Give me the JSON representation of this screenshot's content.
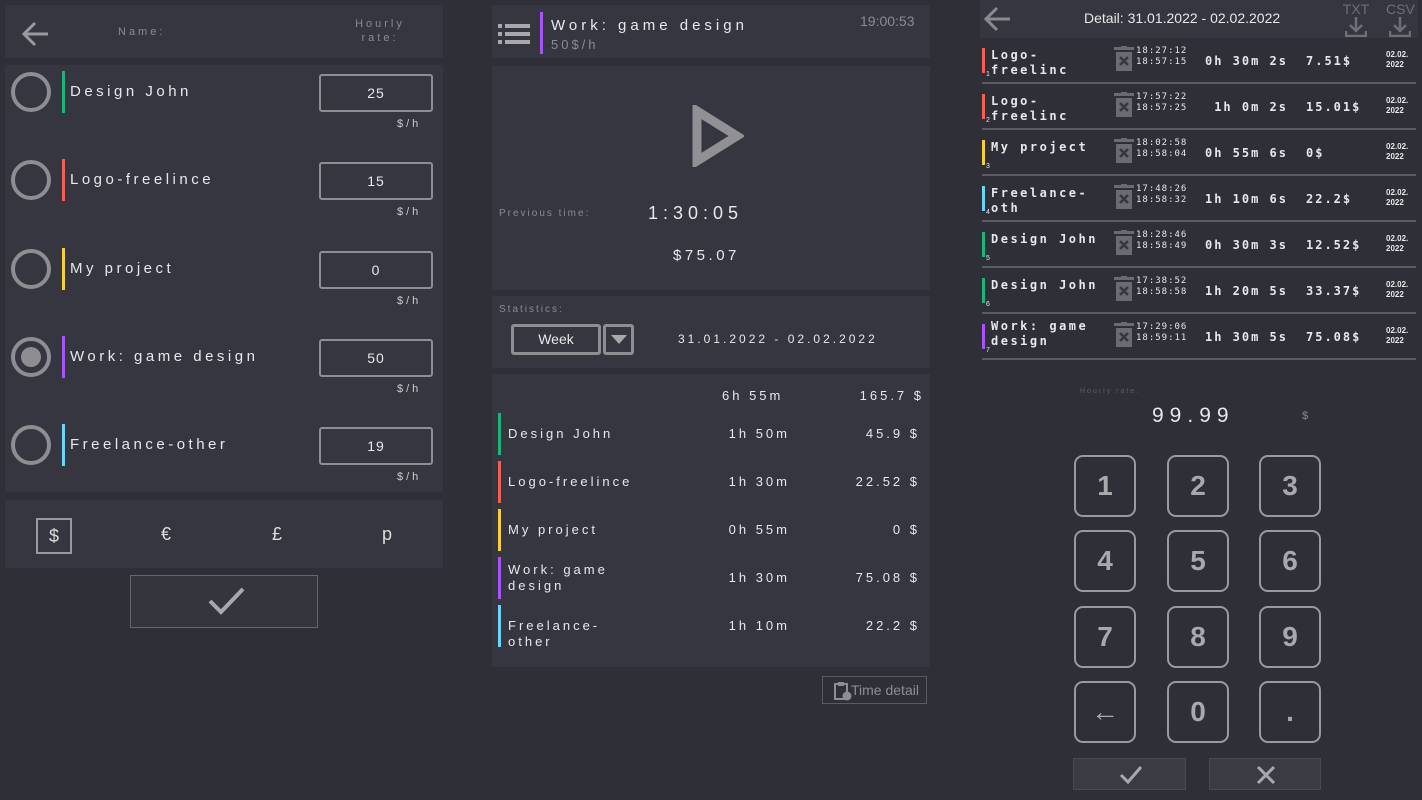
{
  "projects_screen": {
    "header": {
      "name_label": "Name:",
      "rate_label": "Hourly rate:"
    },
    "projects": [
      {
        "name": "Design John",
        "rate": "25",
        "unit": "$/h",
        "color": "#1db37a",
        "selected": false
      },
      {
        "name": "Logo-freelince",
        "rate": "15",
        "unit": "$/h",
        "color": "#f25f55",
        "selected": false
      },
      {
        "name": "My project",
        "rate": "0",
        "unit": "$/h",
        "color": "#f5cf3c",
        "selected": false
      },
      {
        "name": "Work: game design",
        "rate": "50",
        "unit": "$/h",
        "color": "#a855f7",
        "selected": true
      },
      {
        "name": "Freelance-other",
        "rate": "19",
        "unit": "$/h",
        "color": "#6fd3f5",
        "selected": false
      }
    ],
    "currencies": [
      "$",
      "€",
      "£",
      "p"
    ],
    "selected_currency": "$"
  },
  "timer_screen": {
    "project_name": "Work: game design",
    "project_rate": "50$/h",
    "project_color": "#a855f7",
    "clock": "19:00:53",
    "previous_label": "Previous time:",
    "previous_time": "1:30:05",
    "previous_amount": "$75.07",
    "statistics_label": "Statistics:",
    "period": "Week",
    "date_range": "31.01.2022 - 02.02.2022",
    "total_time": "6h 55m",
    "total_amount": "165.7 $",
    "stats": [
      {
        "name": "Design John",
        "time": "1h 50m",
        "amount": "45.9 $",
        "color": "#1db37a"
      },
      {
        "name": "Logo-freelince",
        "time": "1h 30m",
        "amount": "22.52 $",
        "color": "#f25f55"
      },
      {
        "name": "My project",
        "time": "0h 55m",
        "amount": "0 $",
        "color": "#f5cf3c"
      },
      {
        "name": "Work: game design",
        "time": "1h 30m",
        "amount": "75.08 $",
        "color": "#a855f7"
      },
      {
        "name": "Freelance-other",
        "time": "1h 10m",
        "amount": "22.2 $",
        "color": "#6fd3f5"
      }
    ],
    "time_detail_label": "Time detail"
  },
  "detail_screen": {
    "title": "Detail:  31.01.2022 - 02.02.2022",
    "txt_label": "TXT",
    "csv_label": "CSV",
    "entries": [
      {
        "idx": "1",
        "name": "Logo-freelinc",
        "start": "18:27:12",
        "end": "18:57:15",
        "duration": "0h 30m 2s",
        "amount": "7.51$",
        "date1": "02.02.",
        "date2": "2022",
        "color": "#f25f55"
      },
      {
        "idx": "2",
        "name": "Logo-freelinc",
        "start": "17:57:22",
        "end": "18:57:25",
        "duration": "1h 0m 2s",
        "amount": "15.01$",
        "date1": "02.02.",
        "date2": "2022",
        "color": "#f25f55"
      },
      {
        "idx": "3",
        "name": "My project",
        "start": "18:02:58",
        "end": "18:58:04",
        "duration": "0h 55m 6s",
        "amount": "0$",
        "date1": "02.02.",
        "date2": "2022",
        "color": "#f5cf3c"
      },
      {
        "idx": "4",
        "name": "Freelance-oth",
        "start": "17:48:26",
        "end": "18:58:32",
        "duration": "1h 10m 6s",
        "amount": "22.2$",
        "date1": "02.02.",
        "date2": "2022",
        "color": "#6fd3f5"
      },
      {
        "idx": "5",
        "name": "Design John",
        "start": "18:28:46",
        "end": "18:58:49",
        "duration": "0h 30m 3s",
        "amount": "12.52$",
        "date1": "02.02.",
        "date2": "2022",
        "color": "#1db37a"
      },
      {
        "idx": "6",
        "name": "Design John",
        "start": "17:38:52",
        "end": "18:58:58",
        "duration": "1h 20m 5s",
        "amount": "33.37$",
        "date1": "02.02.",
        "date2": "2022",
        "color": "#1db37a"
      },
      {
        "idx": "7",
        "name": "Work: game design",
        "start": "17:29:06",
        "end": "18:59:11",
        "duration": "1h 30m 5s",
        "amount": "75.08$",
        "date1": "02.02.",
        "date2": "2022",
        "color": "#a855f7"
      }
    ],
    "hourly_rate_label": "Hourly rate:",
    "hourly_rate_value": "99.99",
    "hourly_rate_unit": "$",
    "keys": [
      "1",
      "2",
      "3",
      "4",
      "5",
      "6",
      "7",
      "8",
      "9",
      "←",
      "0",
      "."
    ]
  }
}
